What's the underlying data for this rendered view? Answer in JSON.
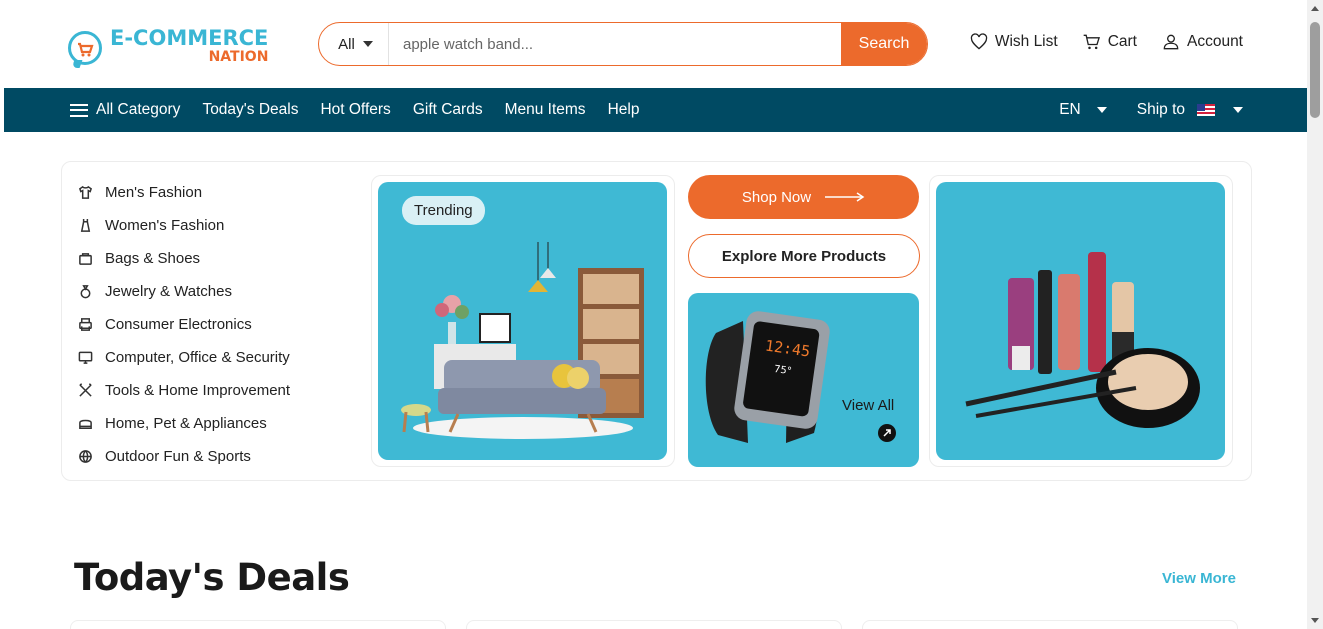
{
  "header": {
    "logo": {
      "top": "E-COMMERCE",
      "bottom": "NATION"
    },
    "search": {
      "category": "All",
      "placeholder": "apple watch band...",
      "button": "Search"
    },
    "links": [
      {
        "label": "Wish List",
        "icon": "heart-icon"
      },
      {
        "label": "Cart",
        "icon": "cart-icon"
      },
      {
        "label": "Account",
        "icon": "user-icon"
      }
    ]
  },
  "nav": {
    "all_category": "All Category",
    "items": [
      "Today's Deals",
      "Hot Offers",
      "Gift Cards",
      "Menu Items",
      "Help"
    ],
    "language": "EN",
    "ship_to": "Ship to"
  },
  "categories": [
    {
      "label": "Men's Fashion",
      "icon": "shirt-icon"
    },
    {
      "label": "Women's Fashion",
      "icon": "dress-icon"
    },
    {
      "label": "Bags & Shoes",
      "icon": "bag-icon"
    },
    {
      "label": "Jewelry & Watches",
      "icon": "ring-icon"
    },
    {
      "label": "Consumer Electronics",
      "icon": "printer-icon"
    },
    {
      "label": "Computer, Office & Security",
      "icon": "monitor-icon"
    },
    {
      "label": "Tools & Home Improvement",
      "icon": "tools-icon"
    },
    {
      "label": "Home, Pet & Appliances",
      "icon": "appliance-icon"
    },
    {
      "label": "Outdoor Fun & Sports",
      "icon": "ball-icon"
    }
  ],
  "hero": {
    "trending": "Trending",
    "shop_now": "Shop Now",
    "explore": "Explore More Products",
    "view_all": "View All",
    "watch_time": "12:45",
    "watch_temp": "75°"
  },
  "deals": {
    "title": "Today's Deals",
    "view_more": "View More"
  },
  "colors": {
    "accent": "#ec6a2c",
    "brand": "#3ab6d4",
    "nav": "#004a63",
    "card": "#3fb9d4"
  }
}
